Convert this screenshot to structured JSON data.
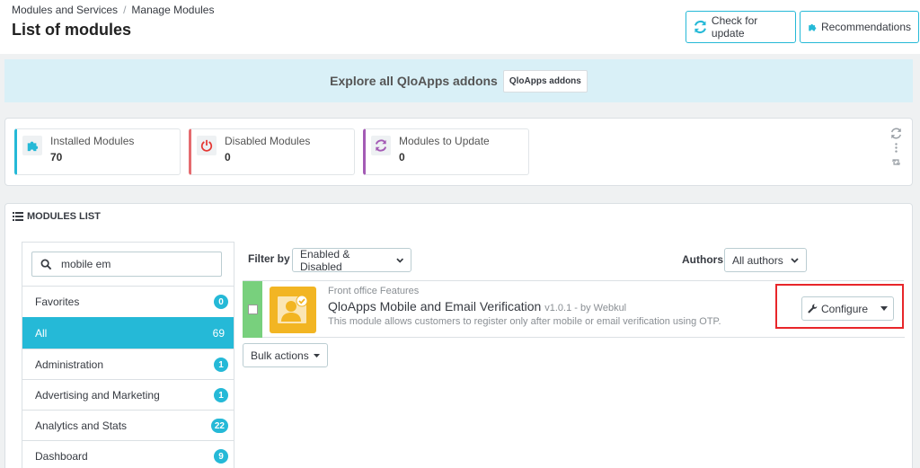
{
  "breadcrumb": {
    "parent": "Modules and Services",
    "separator": "/",
    "current": "Manage Modules"
  },
  "page_title": "List of modules",
  "header_buttons": {
    "check_update": "Check for update",
    "recommendations": "Recommendations"
  },
  "addons_bar": {
    "text": "Explore all QloApps addons",
    "button": "QloApps addons"
  },
  "stats": [
    {
      "label": "Installed Modules",
      "value": "70",
      "color": "#25b9d7",
      "icon": "puzzle-icon"
    },
    {
      "label": "Disabled Modules",
      "value": "0",
      "color": "#e56b6f",
      "icon": "power-icon"
    },
    {
      "label": "Modules to Update",
      "value": "0",
      "color": "#a45bb5",
      "icon": "refresh-icon"
    }
  ],
  "modules_list": {
    "header": "MODULES LIST",
    "search_value": "mobile em",
    "categories": [
      {
        "label": "Favorites",
        "count": "0"
      },
      {
        "label": "All",
        "count": "69"
      },
      {
        "label": "Administration",
        "count": "1"
      },
      {
        "label": "Advertising and Marketing",
        "count": "1"
      },
      {
        "label": "Analytics and Stats",
        "count": "22"
      },
      {
        "label": "Dashboard",
        "count": "9"
      }
    ],
    "filter_label": "Filter by",
    "filter_value": "Enabled & Disabled",
    "authors_label": "Authors",
    "authors_value": "All authors",
    "module": {
      "category": "Front office Features",
      "title": "QloApps Mobile and Email Verification",
      "version": "v1.0.1 - by Webkul",
      "description": "This module allows customers to register only after mobile or email verification using OTP.",
      "action": "Configure"
    },
    "bulk_actions": "Bulk actions"
  },
  "colors": {
    "accent": "#25b9d7",
    "enabled": "#78d07d",
    "highlight": "#e8262a",
    "module_logo": "#f2b523"
  }
}
